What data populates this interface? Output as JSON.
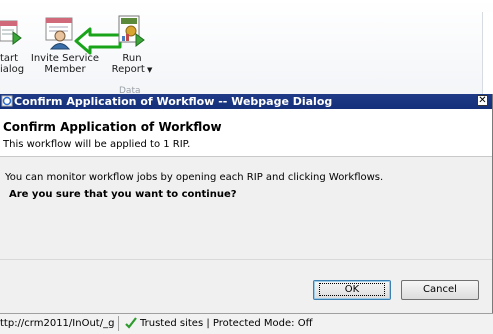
{
  "ribbon": {
    "start_dialog": {
      "line1": "tart",
      "line2": "ialog"
    },
    "invite_member": {
      "line1": "Invite Service",
      "line2": "Member"
    },
    "run_report": {
      "line1": "Run",
      "line2": "Report"
    },
    "group_label": "Data"
  },
  "dialog": {
    "window_title": "Confirm Application of Workflow -- Webpage Dialog",
    "close_glyph": "✕",
    "heading": "Confirm Application of Workflow",
    "subheading": "This workflow will be applied to 1 RIP.",
    "message": "You can monitor workflow jobs by opening each RIP and clicking Workflows.",
    "question": "Are you sure that you want to continue?",
    "ok_label": "OK",
    "cancel_label": "Cancel"
  },
  "statusbar": {
    "url": "ttp://crm2011/InOut/_g",
    "security_zone": "Trusted sites | Protected Mode: Off"
  },
  "colors": {
    "titlebar": "#1f3a87",
    "arrow_green": "#1aa41a",
    "dialog_bg": "#f0f0f0"
  }
}
